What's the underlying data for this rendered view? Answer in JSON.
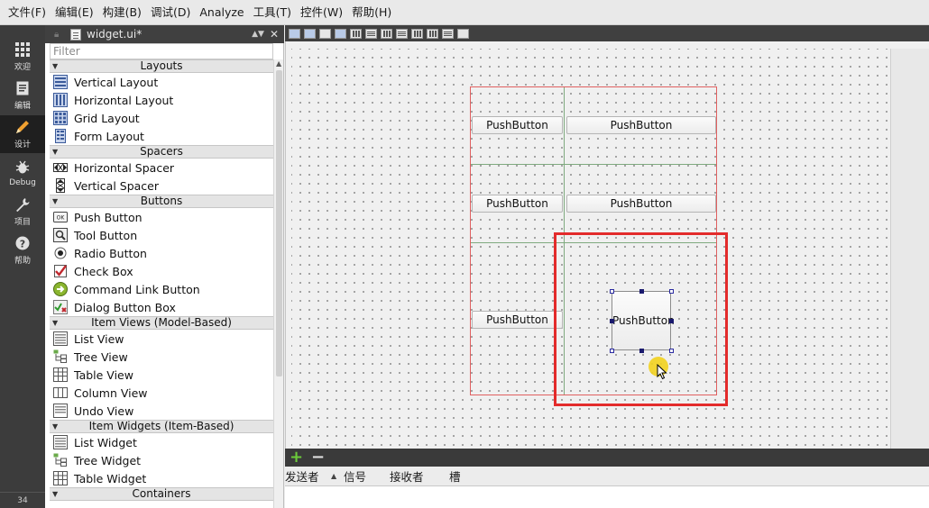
{
  "menubar": {
    "items": [
      "文件(F)",
      "编辑(E)",
      "构建(B)",
      "调试(D)",
      "Analyze",
      "工具(T)",
      "控件(W)",
      "帮助(H)"
    ]
  },
  "modebar": {
    "modes": [
      {
        "label": "欢迎",
        "icon": "grid-icon"
      },
      {
        "label": "编辑",
        "icon": "document-icon"
      },
      {
        "label": "设计",
        "icon": "pencil-icon"
      },
      {
        "label": "Debug",
        "icon": "bug-icon"
      },
      {
        "label": "项目",
        "icon": "wrench-icon"
      },
      {
        "label": "帮助",
        "icon": "help-icon"
      }
    ],
    "active": "设计",
    "bottom_number": "34"
  },
  "document": {
    "title": "widget.ui*"
  },
  "widgetbox": {
    "filter_placeholder": "Filter",
    "categories": [
      {
        "name": "Layouts",
        "items": [
          "Vertical Layout",
          "Horizontal Layout",
          "Grid Layout",
          "Form Layout"
        ]
      },
      {
        "name": "Spacers",
        "items": [
          "Horizontal Spacer",
          "Vertical Spacer"
        ]
      },
      {
        "name": "Buttons",
        "items": [
          "Push Button",
          "Tool Button",
          "Radio Button",
          "Check Box",
          "Command Link Button",
          "Dialog Button Box"
        ]
      },
      {
        "name": "Item Views (Model-Based)",
        "items": [
          "List View",
          "Tree View",
          "Table View",
          "Column View",
          "Undo View"
        ]
      },
      {
        "name": "Item Widgets (Item-Based)",
        "items": [
          "List Widget",
          "Tree Widget",
          "Table Widget"
        ]
      },
      {
        "name": "Containers",
        "items": []
      }
    ]
  },
  "form": {
    "buttons": [
      {
        "label": "PushButton"
      },
      {
        "label": "PushButton"
      },
      {
        "label": "PushButton"
      },
      {
        "label": "PushButton"
      },
      {
        "label": "PushButton"
      },
      {
        "label": "PushButton"
      }
    ]
  },
  "signals": {
    "columns": [
      "发送者",
      "信号",
      "接收者",
      "槽"
    ],
    "add_label": "+",
    "remove_label": "−"
  },
  "colors": {
    "highlight": "#e32b2b",
    "layout_border": "#e06060",
    "grid_line": "#7faa7f",
    "add_green": "#6ccc3a"
  }
}
